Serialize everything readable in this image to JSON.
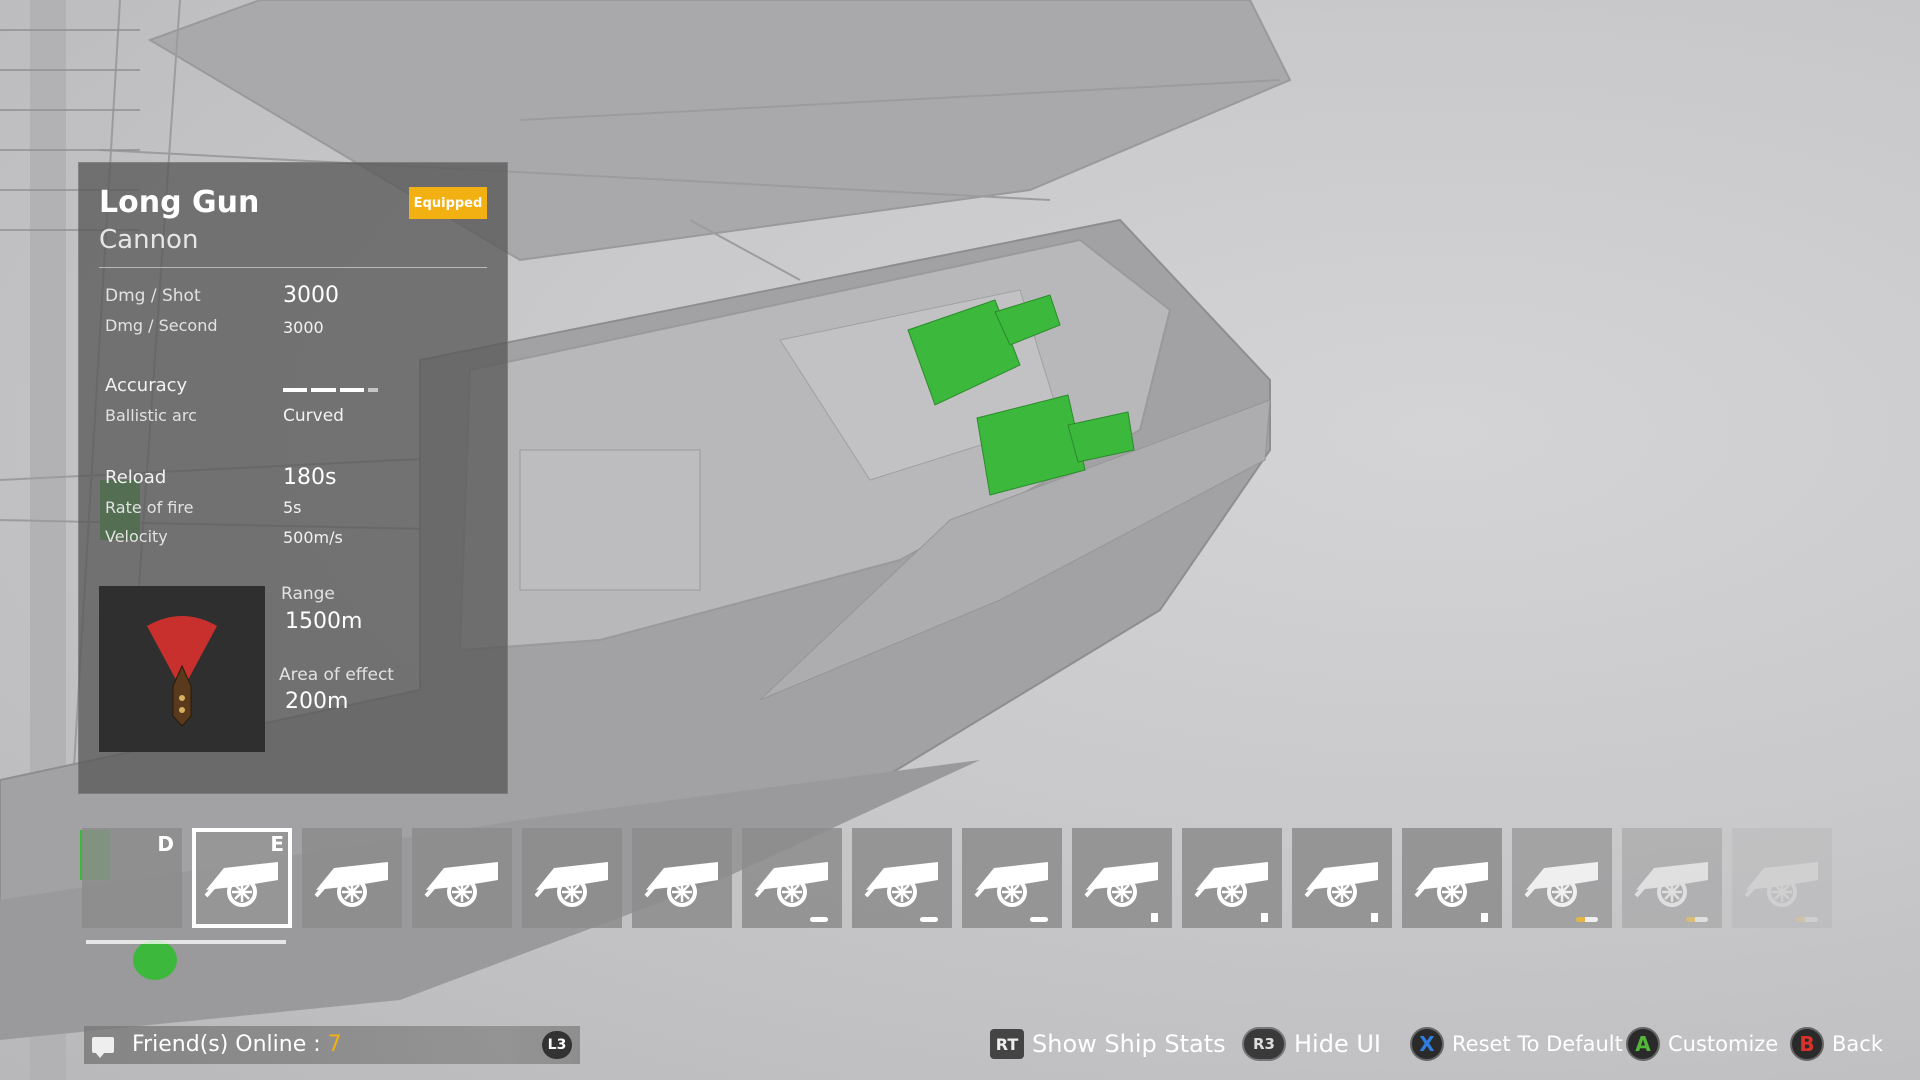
{
  "weapon": {
    "name": "Long Gun",
    "type": "Cannon",
    "status_badge": "Equipped"
  },
  "stats": {
    "dmg_shot_label": "Dmg  / Shot",
    "dmg_shot_value": "3000",
    "dmg_second_label": "Dmg / Second",
    "dmg_second_value": "3000",
    "accuracy_label": "Accuracy",
    "accuracy_level": 0.75,
    "ballistic_label": "Ballistic arc",
    "ballistic_value": "Curved",
    "reload_label": "Reload",
    "reload_value": "180s",
    "rate_label": "Rate of fire",
    "rate_value": "5s",
    "velocity_label": "Velocity",
    "velocity_value": "500m/s",
    "range_label": "Range",
    "range_value": "1500m",
    "aoe_label": "Area of effect",
    "aoe_value": "200m"
  },
  "slots": {
    "first_key": "D",
    "selected_key": "E",
    "count_cannon_slots": 15
  },
  "footer": {
    "friends_label": "Friend(s) Online : ",
    "friends_count": "7",
    "friends_button": "L3",
    "hints": [
      {
        "button": "RT",
        "label": "Show Ship Stats"
      },
      {
        "button": "R3",
        "label": "Hide UI"
      },
      {
        "button": "X",
        "label": "Reset To Default",
        "color": "#2f7de0"
      },
      {
        "button": "A",
        "label": "Customize",
        "color": "#53b83a"
      },
      {
        "button": "B",
        "label": "Back",
        "color": "#d8322d"
      }
    ]
  },
  "colors": {
    "accent": "#f2b013",
    "cannon_highlight": "#3cb83c",
    "range_cone": "#c8302e"
  }
}
